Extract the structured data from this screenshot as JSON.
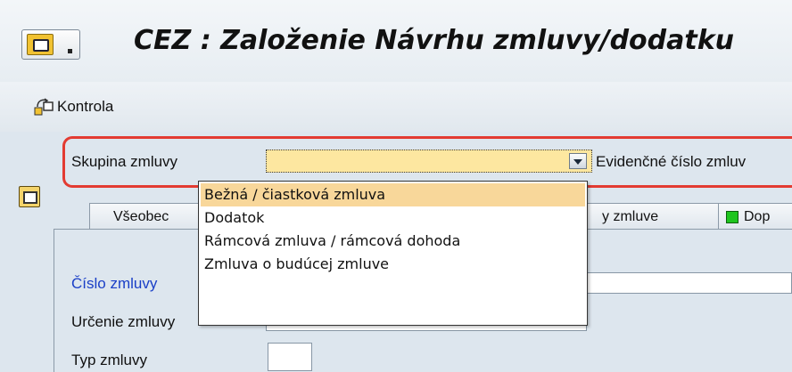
{
  "header": {
    "title": "CEZ : Založenie Návrhu zmluvy/dodatku"
  },
  "toolbar": {
    "check_label": "Kontrola"
  },
  "form": {
    "contract_group_label": "Skupina zmluvy",
    "contract_group_value": "",
    "evidence_number_label": "Evidenčné číslo zmluv",
    "contract_number_label": "Číslo zmluvy",
    "contract_purpose_label": "Určenie zmluvy",
    "contract_type_label": "Typ zmluvy"
  },
  "tabs": [
    {
      "label": "Všeobec"
    },
    {
      "label": "y zmluve"
    },
    {
      "label": "Dop"
    }
  ],
  "dropdown": {
    "options": [
      {
        "label": "Bežná / čiastková zmluva"
      },
      {
        "label": "Dodatok"
      },
      {
        "label": "Rámcová zmluva / rámcová dohoda"
      },
      {
        "label": "Zmluva o budúcej zmluve"
      }
    ]
  },
  "colors": {
    "highlight_border": "#e33b32",
    "combo_background": "#fde7a0",
    "selected_option": "#f8d79a",
    "status_green": "#1ec51e",
    "link_blue": "#1a3fc7"
  }
}
